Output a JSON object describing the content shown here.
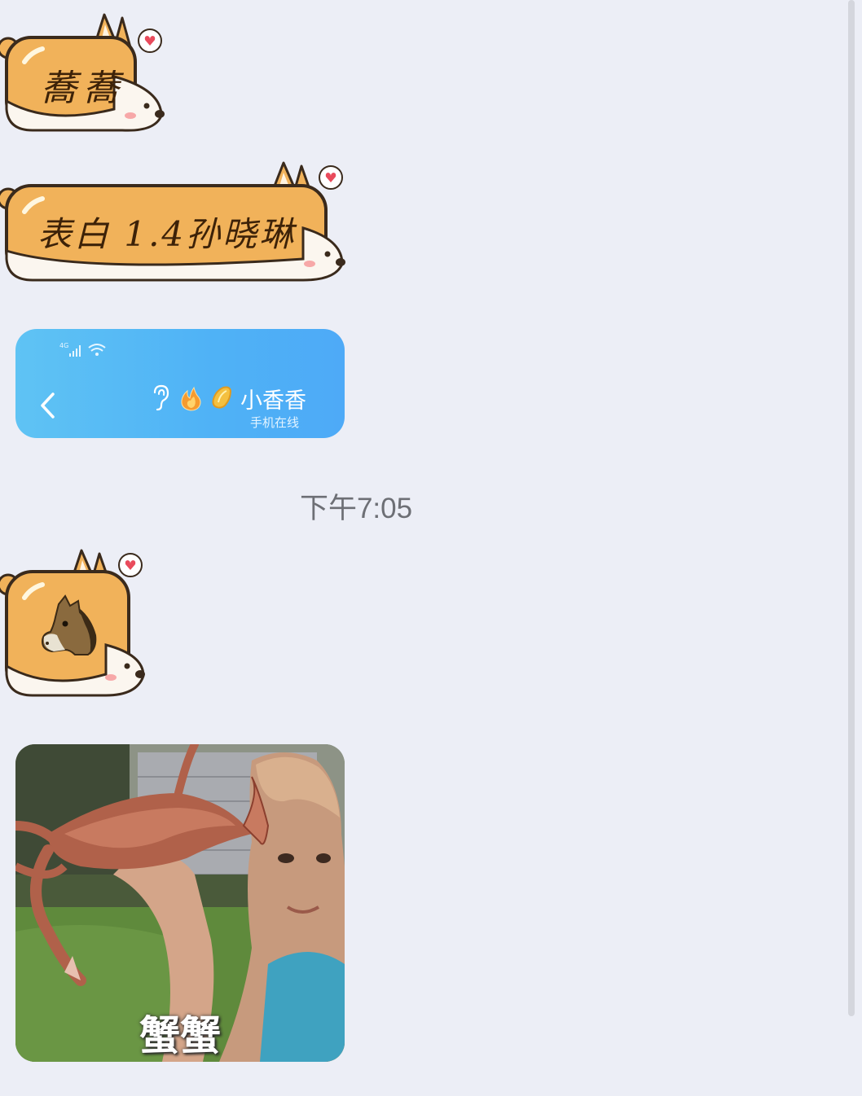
{
  "messages": {
    "sticker_1_text": "蕎蕎",
    "sticker_2_text": "表白 1.4孙晓琳",
    "sticker_3_icon": "horse-face-emoji",
    "chat_header_screenshot": {
      "contact_name": "小香香",
      "contact_status": "手机在线",
      "signal_label": "4G"
    },
    "timestamp": "下午7:05",
    "meme_caption": "蟹蟹"
  },
  "colors": {
    "background": "#eceef6",
    "corgi_body": "#f1b25a",
    "corgi_outline": "#3a2a1c",
    "header_blue": "#4fb2f6",
    "timestamp_gray": "#6d6f75"
  }
}
